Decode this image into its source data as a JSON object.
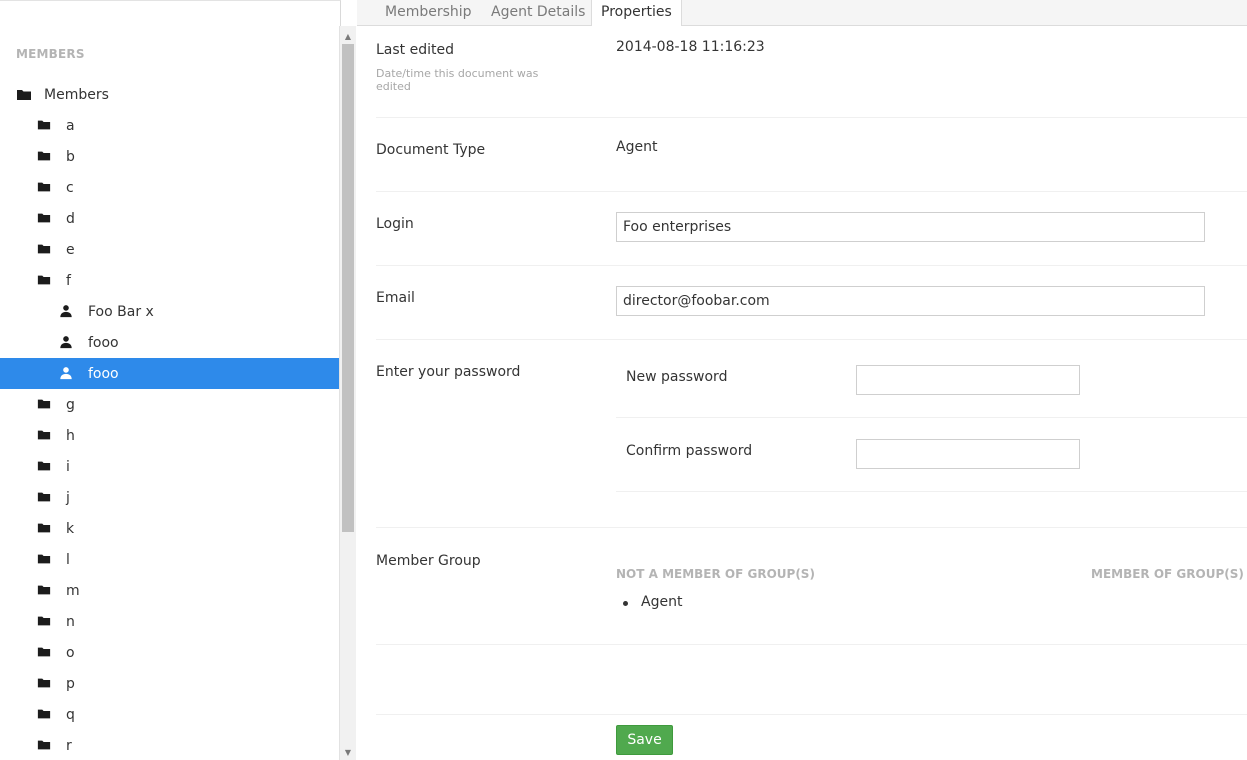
{
  "sidebar": {
    "title": "MEMBERS",
    "root": "Members",
    "items": [
      {
        "label": "a",
        "type": "folder"
      },
      {
        "label": "b",
        "type": "folder"
      },
      {
        "label": "c",
        "type": "folder"
      },
      {
        "label": "d",
        "type": "folder"
      },
      {
        "label": "e",
        "type": "folder"
      },
      {
        "label": "f",
        "type": "folder"
      },
      {
        "label": "Foo Bar x",
        "type": "user"
      },
      {
        "label": "fooo",
        "type": "user"
      },
      {
        "label": "fooo",
        "type": "user",
        "selected": true
      },
      {
        "label": "g",
        "type": "folder"
      },
      {
        "label": "h",
        "type": "folder"
      },
      {
        "label": "i",
        "type": "folder"
      },
      {
        "label": "j",
        "type": "folder"
      },
      {
        "label": "k",
        "type": "folder"
      },
      {
        "label": "l",
        "type": "folder"
      },
      {
        "label": "m",
        "type": "folder"
      },
      {
        "label": "n",
        "type": "folder"
      },
      {
        "label": "o",
        "type": "folder"
      },
      {
        "label": "p",
        "type": "folder"
      },
      {
        "label": "q",
        "type": "folder"
      },
      {
        "label": "r",
        "type": "folder"
      }
    ]
  },
  "tabs": [
    "Membership",
    "Agent Details",
    "Properties"
  ],
  "properties": {
    "last_edited_label": "Last edited",
    "last_edited_desc": "Date/time this document was edited",
    "last_edited_value": "2014-08-18 11:16:23",
    "doc_type_label": "Document Type",
    "doc_type_value": "Agent",
    "login_label": "Login",
    "login_value": "Foo enterprises",
    "email_label": "Email",
    "email_value": "director@foobar.com",
    "password_label": "Enter your password",
    "new_password_label": "New password",
    "confirm_password_label": "Confirm password",
    "member_group_label": "Member Group",
    "not_member_head": "NOT A MEMBER OF GROUP(S)",
    "member_head": "MEMBER OF GROUP(S)",
    "available_group": "Agent"
  },
  "save_label": "Save",
  "colors": {
    "selected_bg": "#2e8aea",
    "save_bg": "#50a94e"
  }
}
